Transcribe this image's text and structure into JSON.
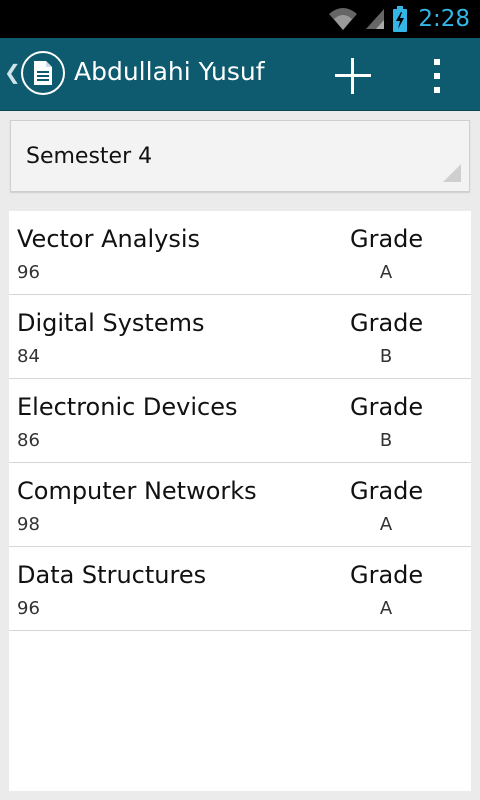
{
  "status_bar": {
    "time": "2:28",
    "icons": [
      "wifi-icon",
      "signal-icon",
      "battery-charging-icon"
    ],
    "accent_color": "#33b5e5"
  },
  "action_bar": {
    "title": "Abdullahi Yusuf",
    "icons": [
      "document-icon",
      "add-icon",
      "overflow-menu-icon"
    ],
    "background_color": "#0e5b6f"
  },
  "semester_spinner": {
    "selected": "Semester 4"
  },
  "courses": [
    {
      "name": "Vector Analysis",
      "score": "96",
      "grade_label": "Grade",
      "grade": "A"
    },
    {
      "name": "Digital Systems",
      "score": "84",
      "grade_label": "Grade",
      "grade": "B"
    },
    {
      "name": "Electronic Devices",
      "score": "86",
      "grade_label": "Grade",
      "grade": "B"
    },
    {
      "name": "Computer Networks",
      "score": "98",
      "grade_label": "Grade",
      "grade": "A"
    },
    {
      "name": "Data Structures",
      "score": "96",
      "grade_label": "Grade",
      "grade": "A"
    }
  ]
}
